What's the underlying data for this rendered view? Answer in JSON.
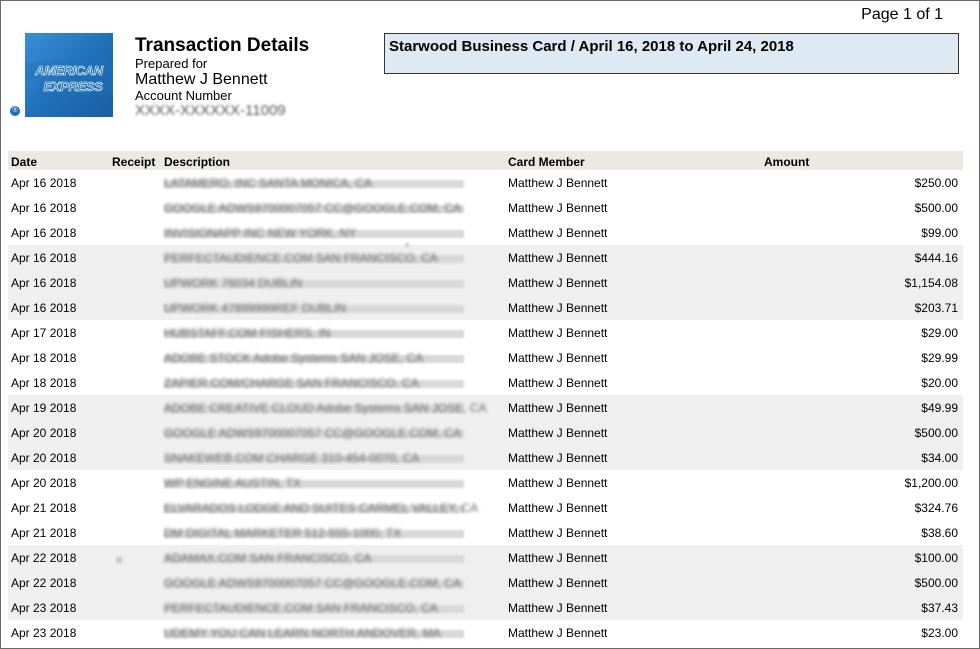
{
  "page_indicator": "Page 1 of 1",
  "header": {
    "logo_line1": "AMERICAN",
    "logo_line2": "EXPRESS",
    "logo_reg": "®",
    "title": "Transaction Details",
    "prepared_for_label": "Prepared for",
    "card_holder": "Matthew J Bennett",
    "account_number_label": "Account Number",
    "account_number_masked": "XXXX-XXXXXX-11009"
  },
  "statement": {
    "title": "Starwood Business Card / April 16, 2018 to April 24, 2018"
  },
  "colors": {
    "brand_blue": "#1f6fb8",
    "header_row_bg": "#ece9e2",
    "statement_box_bg": "#dde9f3",
    "shaded_row_bg": "#efefef"
  },
  "table": {
    "columns": {
      "date": "Date",
      "receipt": "Receipt",
      "description": "Description",
      "card_member": "Card Member",
      "amount": "Amount"
    },
    "rows": [
      {
        "date": "Apr 16 2018",
        "description": "LATAMERO, INC SANTA MONICA, CA",
        "member": "Matthew J Bennett",
        "amount": "$250.00",
        "shaded": false
      },
      {
        "date": "Apr 16 2018",
        "description": "GOOGLE ADWS9700007057 CC@GOOGLE.COM, CA",
        "member": "Matthew J Bennett",
        "amount": "$500.00",
        "shaded": false
      },
      {
        "date": "Apr 16 2018",
        "description": "INVISIONAPP INC NEW YORK, NY",
        "member": "Matthew J Bennett",
        "amount": "$99.00",
        "shaded": false
      },
      {
        "date": "Apr 16 2018",
        "description": "PERFECTAUDIENCE.COM SAN FRANCISCO, CA",
        "member": "Matthew J Bennett",
        "amount": "$444.16",
        "shaded": true
      },
      {
        "date": "Apr 16 2018",
        "description": "UPWORK 76034 DUBLIN",
        "member": "Matthew J Bennett",
        "amount": "$1,154.08",
        "shaded": true
      },
      {
        "date": "Apr 16 2018",
        "description": "UPWORK 47899999REF DUBLIN",
        "member": "Matthew J Bennett",
        "amount": "$203.71",
        "shaded": true
      },
      {
        "date": "Apr 17 2018",
        "description": "HUBSTAFF.COM FISHERS, IN",
        "member": "Matthew J Bennett",
        "amount": "$29.00",
        "shaded": false
      },
      {
        "date": "Apr 18 2018",
        "description": "ADOBE STOCK Adobe Systems SAN JOSE, CA",
        "member": "Matthew J Bennett",
        "amount": "$29.99",
        "shaded": false
      },
      {
        "date": "Apr 18 2018",
        "description": "ZAPIER.COM/CHARGE SAN FRANCISCO, CA",
        "member": "Matthew J Bennett",
        "amount": "$20.00",
        "shaded": false
      },
      {
        "date": "Apr 19 2018",
        "description": "ADOBE CREATIVE CLOUD Adobe Systems SAN JOSE, CA",
        "member": "Matthew J Bennett",
        "amount": "$49.99",
        "shaded": true
      },
      {
        "date": "Apr 20 2018",
        "description": "GOOGLE ADWS9700007057 CC@GOOGLE.COM, CA",
        "member": "Matthew J Bennett",
        "amount": "$500.00",
        "shaded": true
      },
      {
        "date": "Apr 20 2018",
        "description": "SNAKEWEB.COM CHARGE 310-454-0070, CA",
        "member": "Matthew J Bennett",
        "amount": "$34.00",
        "shaded": true
      },
      {
        "date": "Apr 20 2018",
        "description": "WP ENGINE AUSTIN, TX",
        "member": "Matthew J Bennett",
        "amount": "$1,200.00",
        "shaded": false
      },
      {
        "date": "Apr 21 2018",
        "description": "ELVARADOS LODGE AND SUITES CARMEL VALLEY, CA",
        "member": "Matthew J Bennett",
        "amount": "$324.76",
        "shaded": false
      },
      {
        "date": "Apr 21 2018",
        "description": "DM DIGITAL MARKETER 512-555-1000, TX",
        "member": "Matthew J Bennett",
        "amount": "$38.60",
        "shaded": false
      },
      {
        "date": "Apr 22 2018",
        "description": "ADAMAX.COM SAN FRANCISCO, CA",
        "member": "Matthew J Bennett",
        "amount": "$100.00",
        "shaded": true
      },
      {
        "date": "Apr 22 2018",
        "description": "GOOGLE ADWS9700007057 CC@GOOGLE.COM, CA",
        "member": "Matthew J Bennett",
        "amount": "$500.00",
        "shaded": true
      },
      {
        "date": "Apr 23 2018",
        "description": "PERFECTAUDIENCE.COM SAN FRANCISCO, CA",
        "member": "Matthew J Bennett",
        "amount": "$37.43",
        "shaded": true
      },
      {
        "date": "Apr 23 2018",
        "description": "UDEMY YOU CAN LEARN NORTH ANDOVER, MA",
        "member": "Matthew J Bennett",
        "amount": "$23.00",
        "shaded": false
      }
    ]
  }
}
